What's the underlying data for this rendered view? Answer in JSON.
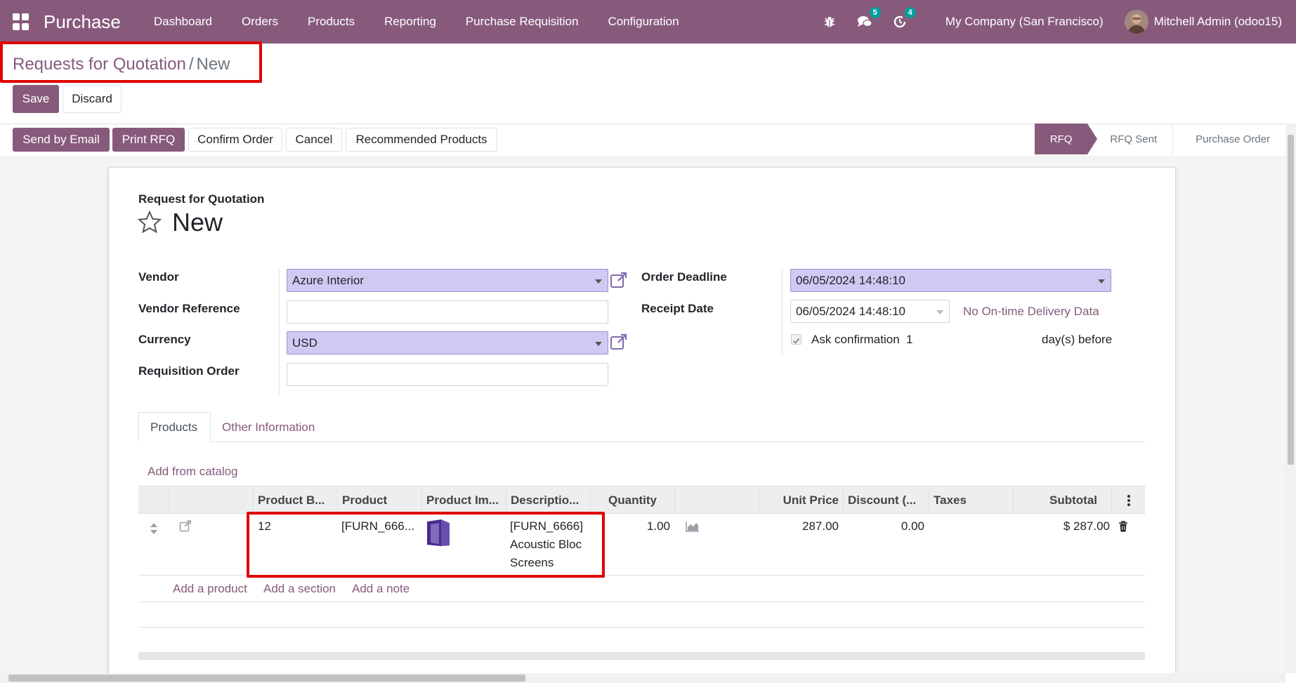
{
  "navbar": {
    "app_name": "Purchase",
    "menu": [
      "Dashboard",
      "Orders",
      "Products",
      "Reporting",
      "Purchase Requisition",
      "Configuration"
    ],
    "chat_count": "5",
    "activity_count": "4",
    "company": "My Company (San Francisco)",
    "user": "Mitchell Admin (odoo15)"
  },
  "breadcrumb": {
    "parent": "Requests for Quotation",
    "separator": "/",
    "current": "New"
  },
  "control": {
    "save": "Save",
    "discard": "Discard"
  },
  "actions": {
    "send_email": "Send by Email",
    "print_rfq": "Print RFQ",
    "confirm": "Confirm Order",
    "cancel": "Cancel",
    "recommended": "Recommended Products"
  },
  "status_stages": [
    "RFQ",
    "RFQ Sent",
    "Purchase Order"
  ],
  "form": {
    "header_label": "Request for Quotation",
    "title": "New",
    "vendor_label": "Vendor",
    "vendor_value": "Azure Interior",
    "vendor_ref_label": "Vendor Reference",
    "vendor_ref_value": "",
    "currency_label": "Currency",
    "currency_value": "USD",
    "requisition_label": "Requisition Order",
    "requisition_value": "",
    "order_deadline_label": "Order Deadline",
    "order_deadline_value": "06/05/2024 14:48:10",
    "receipt_date_label": "Receipt Date",
    "receipt_date_value": "06/05/2024 14:48:10",
    "delivery_link": "No On-time Delivery Data",
    "ask_confirmation_label": "Ask confirmation",
    "ask_confirmation_days": "1",
    "days_before": "day(s) before"
  },
  "tabs": [
    "Products",
    "Other Information"
  ],
  "lines": {
    "add_catalog": "Add from catalog",
    "columns": [
      "Product B...",
      "Product",
      "Product Im...",
      "Descriptio...",
      "Quantity",
      "Unit Price",
      "Discount (...",
      "Taxes",
      "Subtotal"
    ],
    "row": {
      "barcode": "12",
      "product": "[FURN_666...",
      "description_1": "[FURN_6666]",
      "description_2": "Acoustic Bloc",
      "description_3": "Screens",
      "quantity": "1.00",
      "unit_price": "287.00",
      "discount": "0.00",
      "taxes": "",
      "subtotal": "$ 287.00"
    },
    "add_product": "Add a product",
    "add_section": "Add a section",
    "add_note": "Add a note"
  },
  "colors": {
    "brand": "#875a7b",
    "required_field": "#d2c8f4",
    "highlight": "#e00000",
    "badge": "#00a09d"
  }
}
